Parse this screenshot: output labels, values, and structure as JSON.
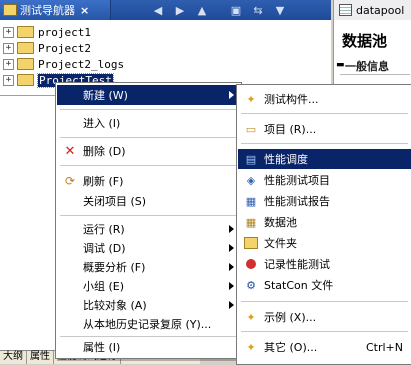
{
  "navigator": {
    "title": "测试导航器",
    "close": "×",
    "toolbar": [
      "◀",
      "▶",
      "▲",
      "▣",
      "⇆",
      "▼"
    ],
    "items": [
      {
        "label": "project1",
        "expander": "+"
      },
      {
        "label": "Project2",
        "expander": "+"
      },
      {
        "label": "Project2_logs",
        "expander": "+"
      },
      {
        "label": "ProjectTest",
        "expander": "+",
        "selected": true
      }
    ]
  },
  "datapool": {
    "tab_title": "datapool",
    "heading": "数据池",
    "section": "一般信息"
  },
  "bottom_tabs": [
    "大纲",
    "属性",
    "性能测试运行"
  ],
  "context_menu": {
    "items": [
      {
        "label": "新建 (W)",
        "submenu": true,
        "highlighted": true
      },
      {
        "separator": true
      },
      {
        "label": "进入 (I)"
      },
      {
        "separator": true
      },
      {
        "label": "删除 (D)",
        "icon": "delete-icon"
      },
      {
        "separator": true
      },
      {
        "label": "刷新 (F)",
        "icon": "refresh-icon"
      },
      {
        "label": "关闭项目 (S)"
      },
      {
        "separator": true
      },
      {
        "label": "运行 (R)",
        "submenu": true
      },
      {
        "label": "调试 (D)",
        "submenu": true
      },
      {
        "label": "概要分析 (F)",
        "submenu": true
      },
      {
        "label": "小组 (E)",
        "submenu": true
      },
      {
        "label": "比较对象 (A)",
        "submenu": true
      },
      {
        "label": "从本地历史记录复原 (Y)..."
      },
      {
        "separator": true
      },
      {
        "label": "属性 (I)"
      }
    ]
  },
  "new_submenu": {
    "items": [
      {
        "label": "测试构件...",
        "icon": "test-asset-icon"
      },
      {
        "separator": true
      },
      {
        "label": "项目 (R)...",
        "icon": "project-icon"
      },
      {
        "separator": true
      },
      {
        "label": "性能调度",
        "icon": "performance-schedule-icon",
        "highlighted": true
      },
      {
        "label": "性能测试项目",
        "icon": "performance-project-icon"
      },
      {
        "label": "性能测试报告",
        "icon": "performance-report-icon"
      },
      {
        "label": "数据池",
        "icon": "datapool-icon"
      },
      {
        "label": "文件夹",
        "icon": "folder-icon"
      },
      {
        "label": "记录性能测试",
        "icon": "record-icon"
      },
      {
        "label": "StatCon 文件",
        "icon": "statcon-icon"
      },
      {
        "separator": true
      },
      {
        "label": "示例 (X)...",
        "icon": "example-icon"
      },
      {
        "separator": true
      },
      {
        "label": "其它 (O)...",
        "icon": "other-icon",
        "accelerator": "Ctrl+N"
      }
    ]
  },
  "colors": {
    "selection": "#0a246a",
    "title_bar": "#2656a8",
    "folder": "#f3d36a",
    "delete": "#d22020",
    "record": "#d03030"
  }
}
